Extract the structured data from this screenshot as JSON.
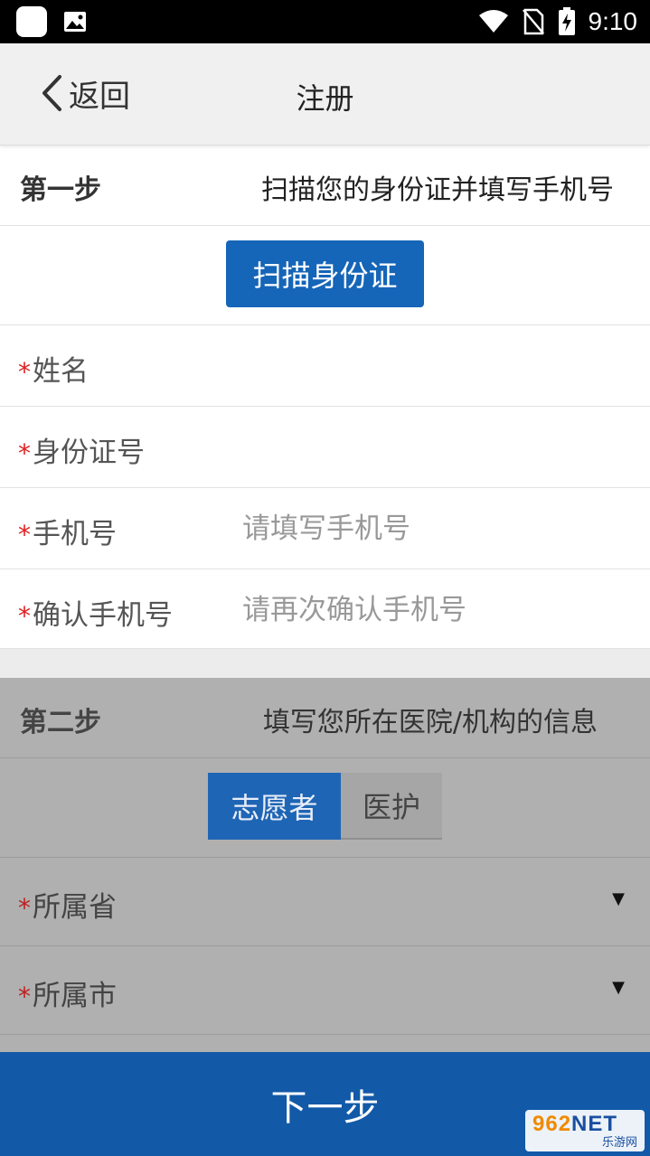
{
  "status_bar": {
    "time": "9:10"
  },
  "nav": {
    "back_label": "返回",
    "title": "注册"
  },
  "step1": {
    "label": "第一步",
    "desc": "扫描您的身份证并填写手机号",
    "scan_button": "扫描身份证",
    "fields": [
      {
        "label": "姓名",
        "required_mark": "*",
        "placeholder": ""
      },
      {
        "label": "身份证号",
        "required_mark": "*",
        "placeholder": ""
      },
      {
        "label": "手机号",
        "required_mark": "*",
        "placeholder": "请填写手机号"
      },
      {
        "label": "确认手机号",
        "required_mark": "*",
        "placeholder": "请再次确认手机号"
      }
    ]
  },
  "step2": {
    "label": "第二步",
    "desc": "填写您所在医院/机构的信息",
    "segments": [
      {
        "label": "志愿者",
        "selected": true
      },
      {
        "label": "医护",
        "selected": false
      }
    ],
    "selects": [
      {
        "label": "所属省",
        "required_mark": "*"
      },
      {
        "label": "所属市",
        "required_mark": "*"
      }
    ]
  },
  "next_button": "下一步",
  "watermark": {
    "top": "962",
    "top_suffix": "NET",
    "bottom": "乐游网"
  },
  "colors": {
    "primary": "#1565b8",
    "required": "#e02020",
    "overlay": "#b0b0b0"
  }
}
